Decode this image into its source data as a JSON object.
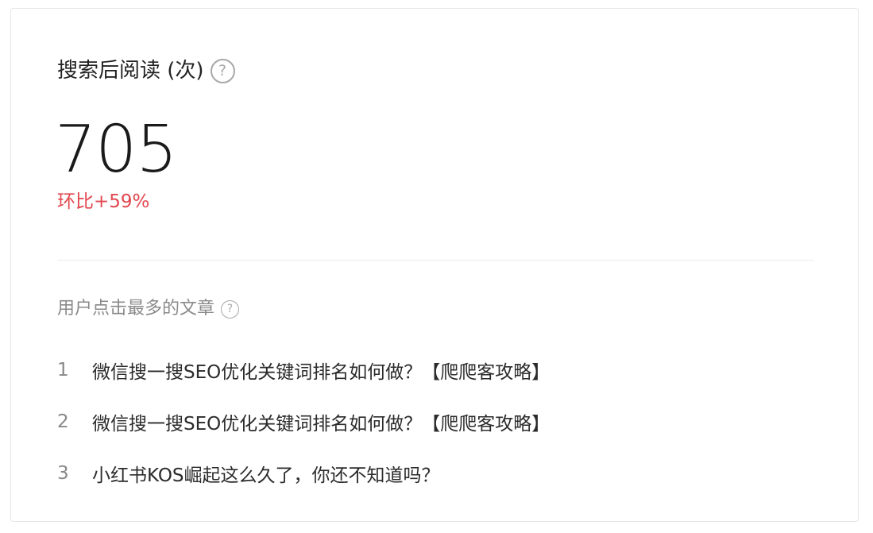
{
  "metric": {
    "title": "搜索后阅读 (次)",
    "help_symbol": "?",
    "value": "705",
    "change": "环比+59%",
    "change_color": "#e2474f"
  },
  "top_articles": {
    "title": "用户点击最多的文章",
    "help_symbol": "?",
    "items": [
      {
        "rank": "1",
        "title": "微信搜一搜SEO优化关键词排名如何做？【爬爬客攻略】"
      },
      {
        "rank": "2",
        "title": "微信搜一搜SEO优化关键词排名如何做？【爬爬客攻略】"
      },
      {
        "rank": "3",
        "title": "小红书KOS崛起这么久了，你还不知道吗？"
      }
    ]
  }
}
